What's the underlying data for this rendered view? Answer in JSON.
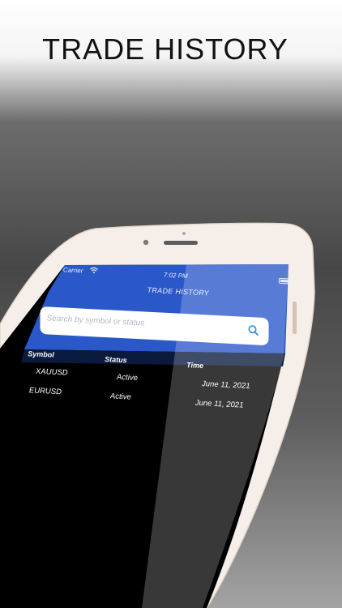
{
  "headline": "TRADE HISTORY",
  "status_bar": {
    "carrier": "Carrier",
    "time": "7:02 PM"
  },
  "nav": {
    "title": "TRADE HISTORY"
  },
  "search": {
    "placeholder": "Search by symbol or status"
  },
  "table": {
    "headers": {
      "symbol": "Symbol",
      "status": "Status",
      "time": "Time"
    },
    "rows": [
      {
        "symbol": "XAUUSD",
        "status": "Active",
        "time": "June 11, 2021"
      },
      {
        "symbol": "EURUSD",
        "status": "Active",
        "time": "June 11, 2021"
      }
    ]
  },
  "colors": {
    "accent": "#2a58c9",
    "screen_bg": "#000000",
    "frame": "#f3ece6"
  }
}
